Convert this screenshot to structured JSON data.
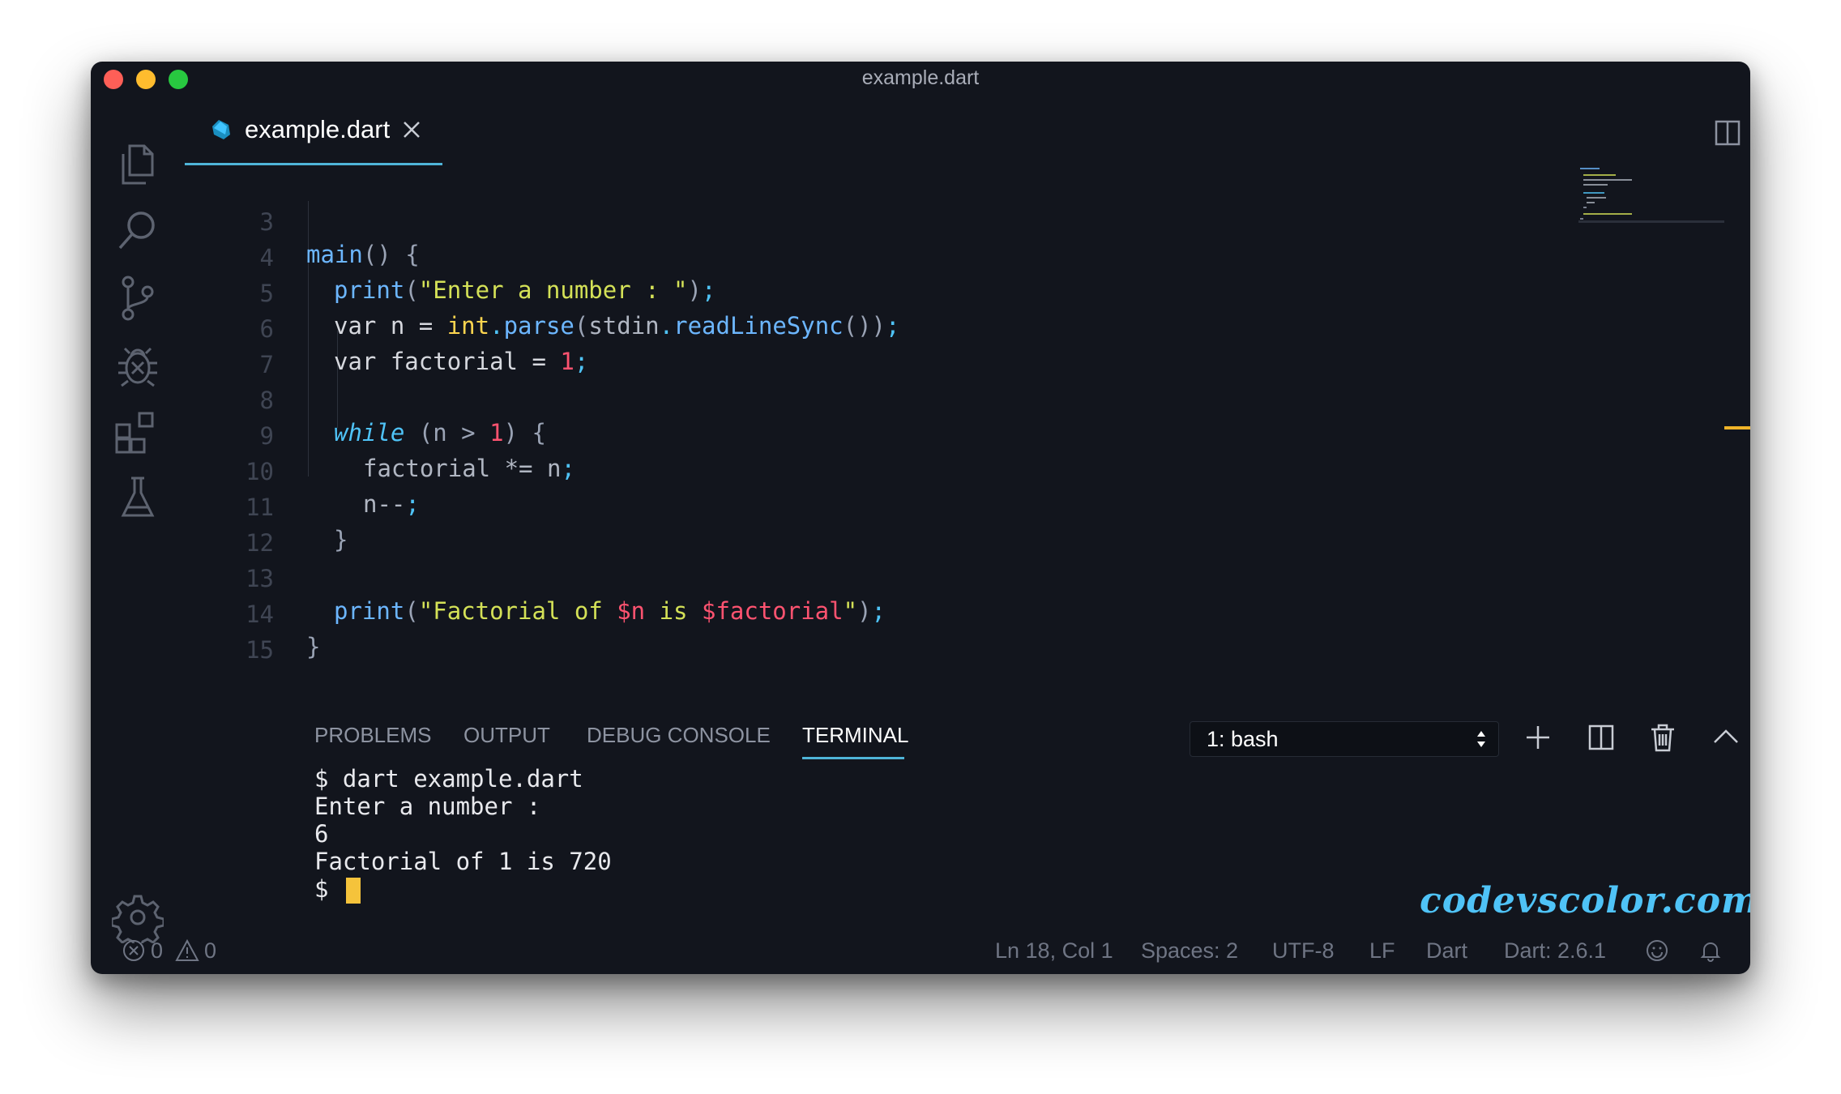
{
  "window": {
    "title": "example.dart"
  },
  "tab": {
    "label": "example.dart"
  },
  "editor": {
    "lines": [
      {
        "n": "3"
      },
      {
        "n": "4"
      },
      {
        "n": "5"
      },
      {
        "n": "6"
      },
      {
        "n": "7"
      },
      {
        "n": "8"
      },
      {
        "n": "9"
      },
      {
        "n": "10"
      },
      {
        "n": "11"
      },
      {
        "n": "12"
      },
      {
        "n": "13"
      },
      {
        "n": "14"
      },
      {
        "n": "15"
      }
    ],
    "code": {
      "l3_fn": "main",
      "l3_rest": "() {",
      "l4_fn": "print",
      "l4_open": "(",
      "l4_str": "\"Enter a number : \"",
      "l4_close": ")",
      "l4_semi": ";",
      "l5_kw": "var",
      "l5_mid": " n = ",
      "l5_type": "int",
      "l5_dot": ".",
      "l5_fn": "parse",
      "l5_open": "(",
      "l5_id": "stdin",
      "l5_dot2": ".",
      "l5_fn2": "readLineSync",
      "l5_close": "())",
      "l5_semi": ";",
      "l6_kw": "var",
      "l6_mid": " factorial = ",
      "l6_num": "1",
      "l6_semi": ";",
      "l8_kw": "while",
      "l8_a": " (n > ",
      "l8_num": "1",
      "l8_b": ") {",
      "l9_a": "factorial *= n",
      "l9_semi": ";",
      "l10_a": "n--",
      "l10_semi": ";",
      "l11": "}",
      "l13_fn": "print",
      "l13_open": "(",
      "l13_s1": "\"Factorial of ",
      "l13_v1": "$n",
      "l13_s2": " is ",
      "l13_v2": "$factorial",
      "l13_s3": "\"",
      "l13_close": ")",
      "l13_semi": ";",
      "l14": "}"
    }
  },
  "panel": {
    "tabs": [
      "PROBLEMS",
      "OUTPUT",
      "DEBUG CONSOLE",
      "TERMINAL"
    ],
    "active_tab": "TERMINAL",
    "terminal_select": "1: bash"
  },
  "terminal": {
    "lines": [
      "$ dart example.dart",
      "Enter a number :",
      "6",
      "Factorial of 1 is 720",
      "$"
    ]
  },
  "watermark": "codevscolor.com",
  "statusbar": {
    "errors": "0",
    "warnings": "0",
    "position": "Ln 18, Col 1",
    "spaces": "Spaces: 2",
    "encoding": "UTF-8",
    "eol": "LF",
    "language": "Dart",
    "sdk": "Dart: 2.6.1"
  },
  "colors": {
    "background": "#12151d",
    "accent": "#4fb4d8",
    "cursor": "#f5c33b"
  },
  "icons": [
    "files-icon",
    "search-icon",
    "source-control-icon",
    "debug-icon",
    "extensions-icon",
    "test-flask-icon",
    "settings-gear-icon",
    "dart-icon",
    "close-icon",
    "split-editor-icon",
    "more-icon",
    "add-terminal-icon",
    "split-terminal-icon",
    "trash-icon",
    "chevron-up-icon",
    "error-icon",
    "warning-icon",
    "smiley-icon",
    "bell-icon"
  ]
}
